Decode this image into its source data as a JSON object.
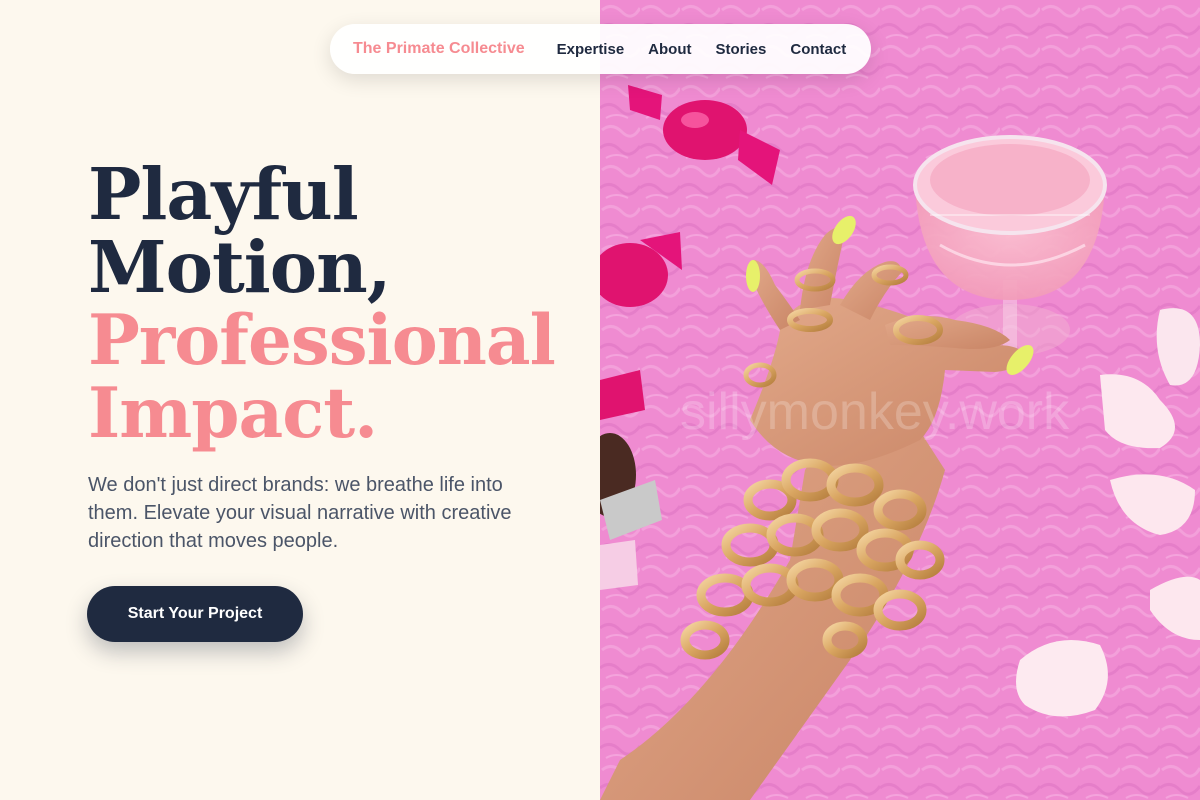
{
  "nav": {
    "brand": "The Primate Collective",
    "links": [
      "Expertise",
      "About",
      "Stories",
      "Contact"
    ]
  },
  "hero": {
    "title_line1": "Playful",
    "title_line2": "Motion,",
    "title_line3": "Professional",
    "title_line4": "Impact.",
    "subtitle": "We don't just direct brands: we breathe life into them. Elevate your visual narrative with creative direction that moves people.",
    "cta_label": "Start Your Project"
  },
  "image": {
    "watermark": "sillymonkey.work",
    "subject": "hand-with-gold-chain-bracelets-holding-pink-cocktail-on-pink-fur"
  },
  "colors": {
    "background": "#fdf8ee",
    "navy": "#1f2a40",
    "coral": "#f68b91",
    "fur_pink": "#f08bd0",
    "gold": "#d9a561"
  }
}
